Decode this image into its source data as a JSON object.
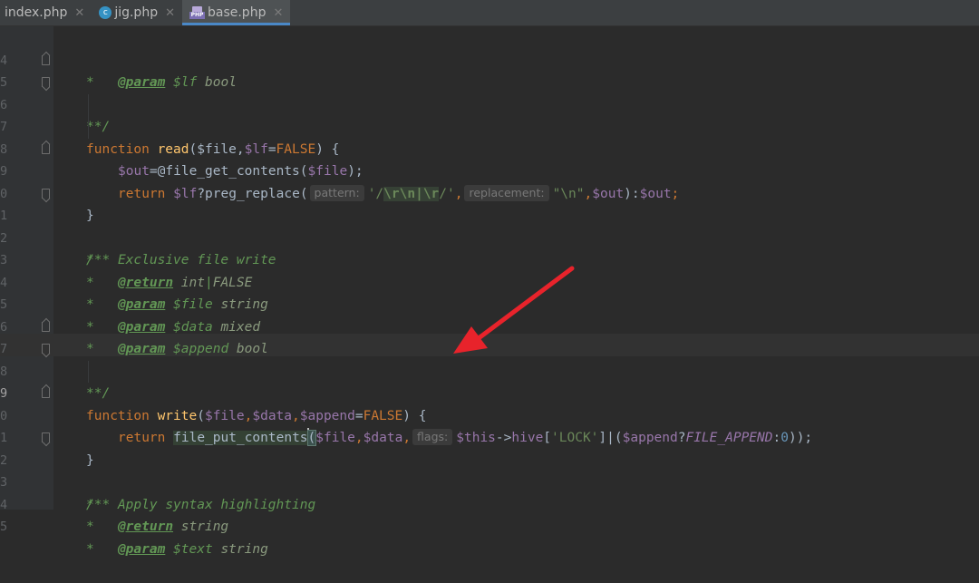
{
  "tabs": [
    {
      "label": "index.php",
      "icon": "none",
      "active": false
    },
    {
      "label": "jig.php",
      "icon": "jig-file-icon",
      "active": false
    },
    {
      "label": "base.php",
      "icon": "php-file-icon",
      "active": true
    }
  ],
  "colors": {
    "background": "#2b2b2b",
    "gutter": "#313335",
    "keyword": "#cc7832",
    "function": "#ffc66d",
    "variable": "#9876aa",
    "string": "#6a8759",
    "doc_comment": "#629755",
    "active_tab_underline": "#4a88c7",
    "annotation_arrow": "#e8232b"
  },
  "line_numbers": [
    "4",
    "5",
    "6",
    "7",
    "8",
    "9",
    "0",
    "1",
    "2",
    "3",
    "4",
    "5",
    "6",
    "7",
    "8",
    "9",
    "0",
    "1",
    "2",
    "3",
    "4",
    "5"
  ],
  "current_line_index": 15,
  "code": {
    "l4": {
      "star": "*",
      "tag": "@param",
      "var": "$lf",
      "type": "bool"
    },
    "l5": {
      "end": "**/"
    },
    "l6": {
      "kw": "function",
      "name": "read",
      "p1": "($file,",
      "p2": "$lf",
      "p3": "=",
      "p4": "FALSE",
      "p5": ") {"
    },
    "l7": {
      "var": "$out",
      "rest": "=@file_get_contents(",
      "arg": "$file",
      "end": ");"
    },
    "l8": {
      "kw": "return",
      "var": "$lf",
      "call": "?preg_replace(",
      "hint1": "pattern:",
      "s1": "'/",
      "s2": "\\r\\n",
      "s3": "|",
      "s4": "\\r",
      "s5": "/'",
      "comma": ",",
      "hint2": "replacement:",
      "s6": "\"\\n\"",
      "rest1": ",",
      "v2": "$out",
      "rest2": "):",
      "v3": "$out",
      "semi": ";"
    },
    "l9": {
      "text": "}"
    },
    "l11": {
      "start": "/**"
    },
    "l12": {
      "star": "*",
      "text": "Exclusive file write"
    },
    "l13": {
      "star": "*",
      "tag": "@return",
      "type1": "int",
      "sep": "|",
      "type2": "FALSE"
    },
    "l14": {
      "star": "*",
      "tag": "@param",
      "var": "$file",
      "type": "string"
    },
    "l15": {
      "star": "*",
      "tag": "@param",
      "var": "$data",
      "type": "mixed"
    },
    "l16": {
      "star": "*",
      "tag": "@param",
      "var": "$append",
      "type": "bool"
    },
    "l17": {
      "end": "**/"
    },
    "l18": {
      "kw": "function",
      "name": "write",
      "p1": "(",
      "v1": "$file",
      "c1": ",",
      "v2": "$data",
      "c2": ",",
      "v3": "$append",
      "eq": "=",
      "f": "FALSE",
      "p2": ") {"
    },
    "l19": {
      "kw": "return",
      "call": "file_put_contents",
      "paren": "(",
      "v1": "$file",
      "c1": ",",
      "v2": "$data",
      "c2": ",",
      "hint": "flags:",
      "v3": "$this",
      "arrow": "->",
      "prop": "hive",
      "br1": "[",
      "s": "'LOCK'",
      "br2": "]|(",
      "v4": "$append",
      "q": "?",
      "k": "FILE_APPEND",
      "colon": ":",
      "n": "0",
      "end": "));"
    },
    "l20": {
      "text": "}"
    },
    "l22": {
      "start": "/**"
    },
    "l23": {
      "star": "*",
      "text": "Apply syntax highlighting"
    },
    "l24": {
      "star": "*",
      "tag": "@return",
      "type": "string"
    },
    "l25": {
      "star": "*",
      "tag": "@param",
      "var": "$text",
      "type": "string"
    }
  }
}
